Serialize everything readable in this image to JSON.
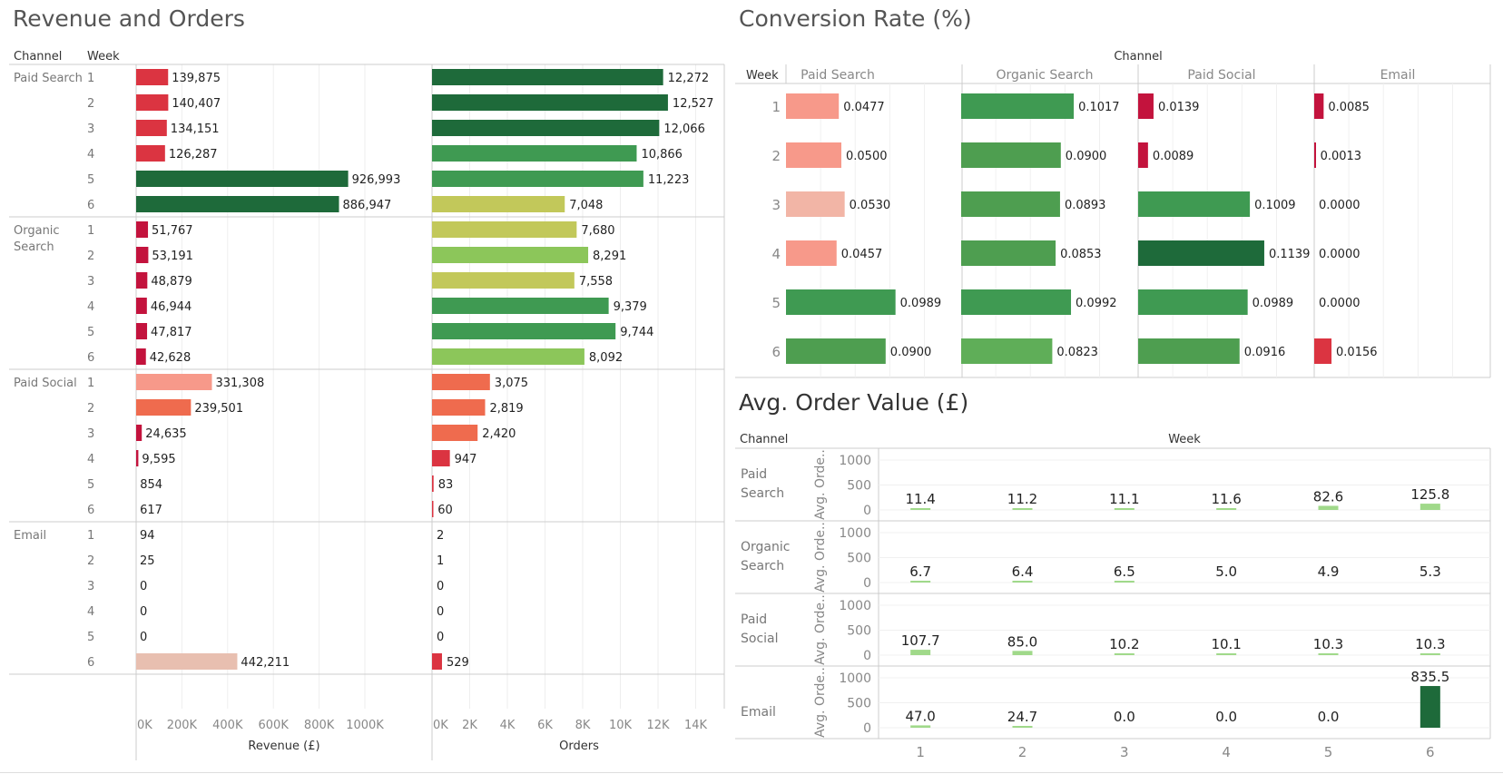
{
  "titles": {
    "left": "Revenue and Orders",
    "conversion": "Conversion Rate (%)",
    "aov": "Avg. Order Value (£)"
  },
  "colors": {
    "green_dark": "#1e6a3a",
    "green": "#3f9a52",
    "green_light": "#8cc65a",
    "yellow_green": "#c2c85a",
    "salmon": "#f7998a",
    "orange": "#ef6b4e",
    "red": "#db3441",
    "crimson": "#c3133d",
    "pale_pink": "#e8bfb0",
    "aov_bar": "#a0d98a"
  },
  "headers": {
    "channel": "Channel",
    "week": "Week",
    "revenue_axis": "Revenue (£)",
    "orders_axis": "Orders",
    "conv_channel_header": "Channel",
    "conv_week_header": "Week",
    "aov_channel_header": "Channel",
    "aov_week_header": "Week",
    "aov_axis_label": "Avg. Orde.."
  },
  "chart_data": [
    {
      "type": "bar",
      "orientation": "horizontal",
      "title": "Revenue and Orders",
      "xlabel": "Revenue (£)",
      "xlim": [
        0,
        1500000
      ],
      "xticks": [
        "0K",
        "200K",
        "400K",
        "600K",
        "800K",
        "1000K"
      ],
      "categories_outer": [
        "Paid Search",
        "Organic Search",
        "Paid Social",
        "Email"
      ],
      "weeks": [
        1,
        2,
        3,
        4,
        5,
        6
      ],
      "series": [
        {
          "name": "Paid Search",
          "values": [
            139875,
            140407,
            134151,
            126287,
            926993,
            886947
          ],
          "labels": [
            "139,875",
            "140,407",
            "134,151",
            "126,287",
            "926,993",
            "886,947"
          ]
        },
        {
          "name": "Organic Search",
          "values": [
            51767,
            53191,
            48879,
            46944,
            47817,
            42628
          ],
          "labels": [
            "51,767",
            "53,191",
            "48,879",
            "46,944",
            "47,817",
            "42,628"
          ]
        },
        {
          "name": "Paid Social",
          "values": [
            331308,
            239501,
            24635,
            9595,
            854,
            617
          ],
          "labels": [
            "331,308",
            "239,501",
            "24,635",
            "9,595",
            "854",
            "617"
          ]
        },
        {
          "name": "Email",
          "values": [
            94,
            25,
            0,
            0,
            0,
            442211
          ],
          "labels": [
            "94",
            "25",
            "0",
            "0",
            "0",
            "442,211"
          ]
        }
      ]
    },
    {
      "type": "bar",
      "orientation": "horizontal",
      "xlabel": "Orders",
      "xlim": [
        0,
        15000
      ],
      "xticks": [
        "0K",
        "2K",
        "4K",
        "6K",
        "8K",
        "10K",
        "12K",
        "14K"
      ],
      "series": [
        {
          "name": "Paid Search",
          "values": [
            12272,
            12527,
            12066,
            10866,
            11223,
            7048
          ],
          "labels": [
            "12,272",
            "12,527",
            "12,066",
            "10,866",
            "11,223",
            "7,048"
          ]
        },
        {
          "name": "Organic Search",
          "values": [
            7680,
            8291,
            7558,
            9379,
            9744,
            8092
          ],
          "labels": [
            "7,680",
            "8,291",
            "7,558",
            "9,379",
            "9,744",
            "8,092"
          ]
        },
        {
          "name": "Paid Social",
          "values": [
            3075,
            2819,
            2420,
            947,
            83,
            60
          ],
          "labels": [
            "3,075",
            "2,819",
            "2,420",
            "947",
            "83",
            "60"
          ]
        },
        {
          "name": "Email",
          "values": [
            2,
            1,
            0,
            0,
            0,
            529
          ],
          "labels": [
            "2",
            "1",
            "0",
            "0",
            "0",
            "529"
          ]
        }
      ]
    },
    {
      "type": "bar",
      "orientation": "horizontal",
      "title": "Conversion Rate (%)",
      "xlim": [
        0,
        0.16
      ],
      "columns": [
        "Paid Search",
        "Organic Search",
        "Paid Social",
        "Email"
      ],
      "weeks": [
        1,
        2,
        3,
        4,
        5,
        6
      ],
      "series": [
        {
          "name": "Paid Search",
          "values": [
            0.0477,
            0.05,
            0.053,
            0.0457,
            0.0989,
            0.09
          ],
          "labels": [
            "0.0477",
            "0.0500",
            "0.0530",
            "0.0457",
            "0.0989",
            "0.0900"
          ]
        },
        {
          "name": "Organic Search",
          "values": [
            0.1017,
            0.09,
            0.0893,
            0.0853,
            0.0992,
            0.0823
          ],
          "labels": [
            "0.1017",
            "0.0900",
            "0.0893",
            "0.0853",
            "0.0992",
            "0.0823"
          ]
        },
        {
          "name": "Paid Social",
          "values": [
            0.0139,
            0.0089,
            0.1009,
            0.1139,
            0.0989,
            0.0916
          ],
          "labels": [
            "0.0139",
            "0.0089",
            "0.1009",
            "0.1139",
            "0.0989",
            "0.0916"
          ]
        },
        {
          "name": "Email",
          "values": [
            0.0085,
            0.0013,
            0.0,
            0.0,
            0.0,
            0.0156
          ],
          "labels": [
            "0.0085",
            "0.0013",
            "0.0000",
            "0.0000",
            "0.0000",
            "0.0156"
          ]
        }
      ]
    },
    {
      "type": "bar",
      "title": "Avg. Order Value (£)",
      "ylabel": "Avg. Orde..",
      "ylim": [
        0,
        1200
      ],
      "yticks": [
        "0",
        "500",
        "1000"
      ],
      "categories": [
        "1",
        "2",
        "3",
        "4",
        "5",
        "6"
      ],
      "series": [
        {
          "name": "Paid Search",
          "values": [
            11.4,
            11.2,
            11.1,
            11.6,
            82.6,
            125.8
          ],
          "labels": [
            "11.4",
            "11.2",
            "11.1",
            "11.6",
            "82.6",
            "125.8"
          ]
        },
        {
          "name": "Organic Search",
          "values": [
            6.7,
            6.4,
            6.5,
            5.0,
            4.9,
            5.3
          ],
          "labels": [
            "6.7",
            "6.4",
            "6.5",
            "5.0",
            "4.9",
            "5.3"
          ]
        },
        {
          "name": "Paid Social",
          "values": [
            107.7,
            85.0,
            10.2,
            10.1,
            10.3,
            10.3
          ],
          "labels": [
            "107.7",
            "85.0",
            "10.2",
            "10.1",
            "10.3",
            "10.3"
          ]
        },
        {
          "name": "Email",
          "values": [
            47.0,
            24.7,
            0.0,
            0.0,
            0.0,
            835.5
          ],
          "labels": [
            "47.0",
            "24.7",
            "0.0",
            "0.0",
            "0.0",
            "835.5"
          ]
        }
      ]
    }
  ]
}
